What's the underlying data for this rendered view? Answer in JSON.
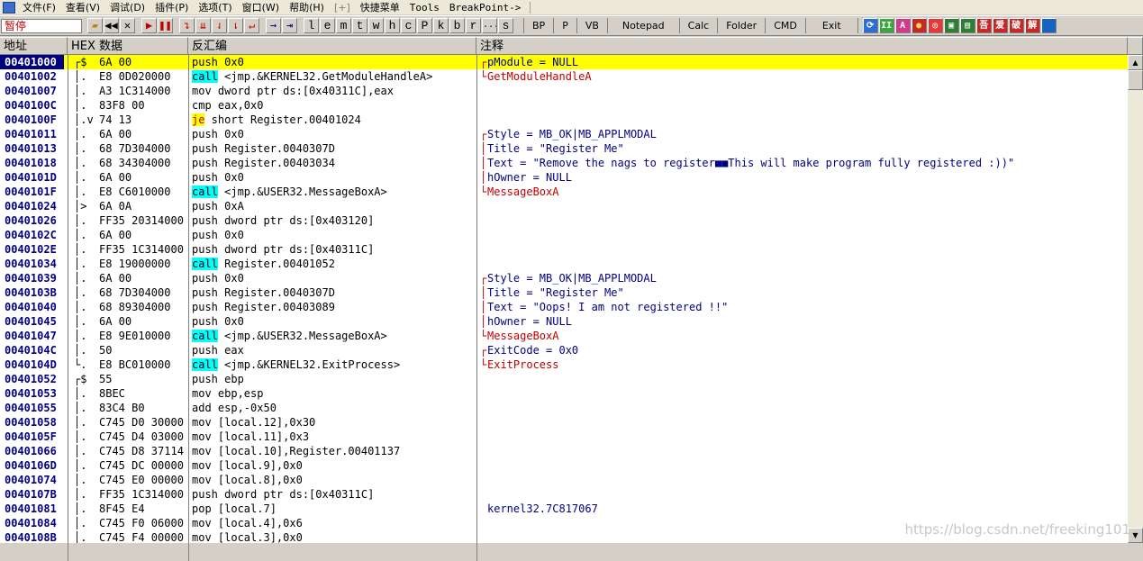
{
  "menu": [
    "文件(F)",
    "查看(V)",
    "调试(D)",
    "插件(P)",
    "选项(T)",
    "窗口(W)",
    "帮助(H)",
    "[+]",
    "快捷菜单",
    "Tools",
    "BreakPoint->"
  ],
  "status": "暂停",
  "toolbar_letters": [
    "l",
    "e",
    "m",
    "t",
    "w",
    "h",
    "c",
    "P",
    "k",
    "b",
    "r",
    "...",
    "s"
  ],
  "toolbar_text": [
    "BP",
    "P",
    "VB",
    "Notepad",
    "Calc",
    "Folder",
    "CMD",
    "Exit"
  ],
  "toolbar_right_glyphs": [
    "⟳",
    "II",
    "A",
    "●",
    "◎",
    "▣",
    "▤",
    "吾",
    "爱",
    "破",
    "解"
  ],
  "columns": {
    "addr": "地址",
    "hex": "HEX 数据",
    "disasm": "反汇编",
    "comment": "注释"
  },
  "rows": [
    {
      "addr": "00401000",
      "mark": "┌$",
      "hex": "6A 00",
      "op": "push",
      "rest": " 0x0",
      "br": "┌",
      "cmt": "pModule = NULL",
      "red": false,
      "sel": true
    },
    {
      "addr": "00401002",
      "mark": "│.",
      "hex": "E8 0D020000",
      "op": "call",
      "rest": " <jmp.&KERNEL32.GetModuleHandleA>",
      "br": "└",
      "cmt": "GetModuleHandleA",
      "red": true
    },
    {
      "addr": "00401007",
      "mark": "│.",
      "hex": "A3 1C314000",
      "op": "mov",
      "rest": " dword ptr ds:[0x40311C],eax",
      "br": "",
      "cmt": ""
    },
    {
      "addr": "0040100C",
      "mark": "│.",
      "hex": "83F8 00",
      "op": "cmp",
      "rest": " eax,0x0",
      "br": "",
      "cmt": ""
    },
    {
      "addr": "0040100F",
      "mark": "│.v",
      "hex": "74 13",
      "op": "je",
      "rest": " short Register.00401024",
      "br": "",
      "cmt": ""
    },
    {
      "addr": "00401011",
      "mark": "│.",
      "hex": "6A 00",
      "op": "push",
      "rest": " 0x0",
      "br": "┌",
      "cmt": "Style = MB_OK|MB_APPLMODAL"
    },
    {
      "addr": "00401013",
      "mark": "│.",
      "hex": "68 7D304000",
      "op": "push",
      "rest": " Register.0040307D",
      "br": "│",
      "cmt": "Title = \"Register Me\""
    },
    {
      "addr": "00401018",
      "mark": "│.",
      "hex": "68 34304000",
      "op": "push",
      "rest": " Register.00403034",
      "br": "│",
      "cmt": "Text = \"Remove the nags to register■■This will make program fully registered :))\""
    },
    {
      "addr": "0040101D",
      "mark": "│.",
      "hex": "6A 00",
      "op": "push",
      "rest": " 0x0",
      "br": "│",
      "cmt": "hOwner = NULL"
    },
    {
      "addr": "0040101F",
      "mark": "│.",
      "hex": "E8 C6010000",
      "op": "call",
      "rest": " <jmp.&USER32.MessageBoxA>",
      "br": "└",
      "cmt": "MessageBoxA",
      "red": true
    },
    {
      "addr": "00401024",
      "mark": "│>",
      "hex": "6A 0A",
      "op": "push",
      "rest": " 0xA",
      "br": "",
      "cmt": ""
    },
    {
      "addr": "00401026",
      "mark": "│.",
      "hex": "FF35 20314000",
      "op": "push",
      "rest": " dword ptr ds:[0x403120]",
      "br": "",
      "cmt": ""
    },
    {
      "addr": "0040102C",
      "mark": "│.",
      "hex": "6A 00",
      "op": "push",
      "rest": " 0x0",
      "br": "",
      "cmt": ""
    },
    {
      "addr": "0040102E",
      "mark": "│.",
      "hex": "FF35 1C314000",
      "op": "push",
      "rest": " dword ptr ds:[0x40311C]",
      "br": "",
      "cmt": ""
    },
    {
      "addr": "00401034",
      "mark": "│.",
      "hex": "E8 19000000",
      "op": "call",
      "rest": " Register.00401052",
      "br": "",
      "cmt": ""
    },
    {
      "addr": "00401039",
      "mark": "│.",
      "hex": "6A 00",
      "op": "push",
      "rest": " 0x0",
      "br": "┌",
      "cmt": "Style = MB_OK|MB_APPLMODAL"
    },
    {
      "addr": "0040103B",
      "mark": "│.",
      "hex": "68 7D304000",
      "op": "push",
      "rest": " Register.0040307D",
      "br": "│",
      "cmt": "Title = \"Register Me\""
    },
    {
      "addr": "00401040",
      "mark": "│.",
      "hex": "68 89304000",
      "op": "push",
      "rest": " Register.00403089",
      "br": "│",
      "cmt": "Text = \"Oops! I am not registered !!\""
    },
    {
      "addr": "00401045",
      "mark": "│.",
      "hex": "6A 00",
      "op": "push",
      "rest": " 0x0",
      "br": "│",
      "cmt": "hOwner = NULL"
    },
    {
      "addr": "00401047",
      "mark": "│.",
      "hex": "E8 9E010000",
      "op": "call",
      "rest": " <jmp.&USER32.MessageBoxA>",
      "br": "└",
      "cmt": "MessageBoxA",
      "red": true
    },
    {
      "addr": "0040104C",
      "mark": "│.",
      "hex": "50",
      "op": "push",
      "rest": " eax",
      "br": "┌",
      "cmt": "ExitCode = 0x0"
    },
    {
      "addr": "0040104D",
      "mark": "└.",
      "hex": "E8 BC010000",
      "op": "call",
      "rest": " <jmp.&KERNEL32.ExitProcess>",
      "br": "└",
      "cmt": "ExitProcess",
      "red": true
    },
    {
      "addr": "00401052",
      "mark": "┌$",
      "hex": "55",
      "op": "push",
      "rest": " ebp",
      "br": "",
      "cmt": ""
    },
    {
      "addr": "00401053",
      "mark": "│.",
      "hex": "8BEC",
      "op": "mov",
      "rest": " ebp,esp",
      "br": "",
      "cmt": ""
    },
    {
      "addr": "00401055",
      "mark": "│.",
      "hex": "83C4 B0",
      "op": "add",
      "rest": " esp,-0x50",
      "br": "",
      "cmt": ""
    },
    {
      "addr": "00401058",
      "mark": "│.",
      "hex": "C745 D0 30000",
      "op": "mov",
      "rest": " [local.12],0x30",
      "br": "",
      "cmt": ""
    },
    {
      "addr": "0040105F",
      "mark": "│.",
      "hex": "C745 D4 03000",
      "op": "mov",
      "rest": " [local.11],0x3",
      "br": "",
      "cmt": ""
    },
    {
      "addr": "00401066",
      "mark": "│.",
      "hex": "C745 D8 37114",
      "op": "mov",
      "rest": " [local.10],Register.00401137",
      "br": "",
      "cmt": ""
    },
    {
      "addr": "0040106D",
      "mark": "│.",
      "hex": "C745 DC 00000",
      "op": "mov",
      "rest": " [local.9],0x0",
      "br": "",
      "cmt": ""
    },
    {
      "addr": "00401074",
      "mark": "│.",
      "hex": "C745 E0 00000",
      "op": "mov",
      "rest": " [local.8],0x0",
      "br": "",
      "cmt": ""
    },
    {
      "addr": "0040107B",
      "mark": "│.",
      "hex": "FF35 1C314000",
      "op": "push",
      "rest": " dword ptr ds:[0x40311C]",
      "br": "",
      "cmt": ""
    },
    {
      "addr": "00401081",
      "mark": "│.",
      "hex": "8F45 E4",
      "op": "pop",
      "rest": " [local.7]",
      "br": "",
      "cmt": "kernel32.7C817067",
      "plain": true
    },
    {
      "addr": "00401084",
      "mark": "│.",
      "hex": "C745 F0 06000",
      "op": "mov",
      "rest": " [local.4],0x6",
      "br": "",
      "cmt": ""
    },
    {
      "addr": "0040108B",
      "mark": "│.",
      "hex": "C745 F4 00000",
      "op": "mov",
      "rest": " [local.3],0x0",
      "br": "",
      "cmt": ""
    }
  ],
  "watermark": "https://blog.csdn.net/freeking101"
}
